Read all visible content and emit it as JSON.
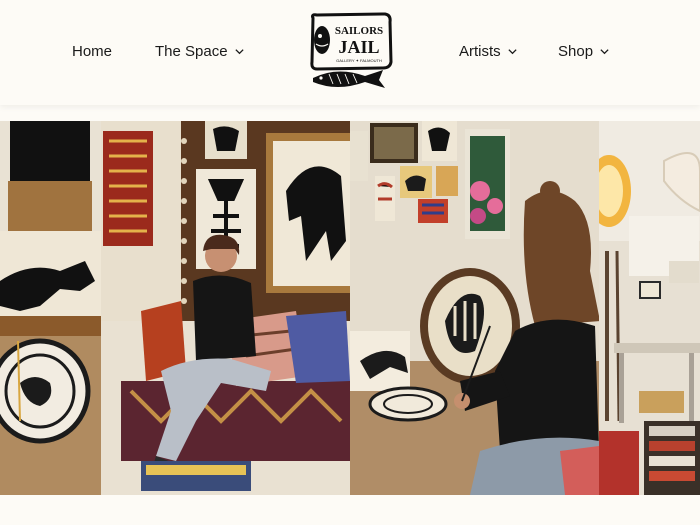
{
  "nav": {
    "left": [
      {
        "label": "Home",
        "has_dropdown": false
      },
      {
        "label": "The Space",
        "has_dropdown": true
      }
    ],
    "right": [
      {
        "label": "Artists",
        "has_dropdown": true
      },
      {
        "label": "Shop",
        "has_dropdown": true
      }
    ]
  },
  "logo": {
    "line1": "SAILORS",
    "line2": "JAIL",
    "subline": "GALLERY ✦ FALMOUTH"
  },
  "gallery": {
    "panels": [
      "studio-easel-photo",
      "artist-on-sofa-photo",
      "artist-painting-pot-photo",
      "studio-interior-photo"
    ]
  },
  "colors": {
    "background": "#fdfbf6",
    "text": "#1a1a1a"
  }
}
